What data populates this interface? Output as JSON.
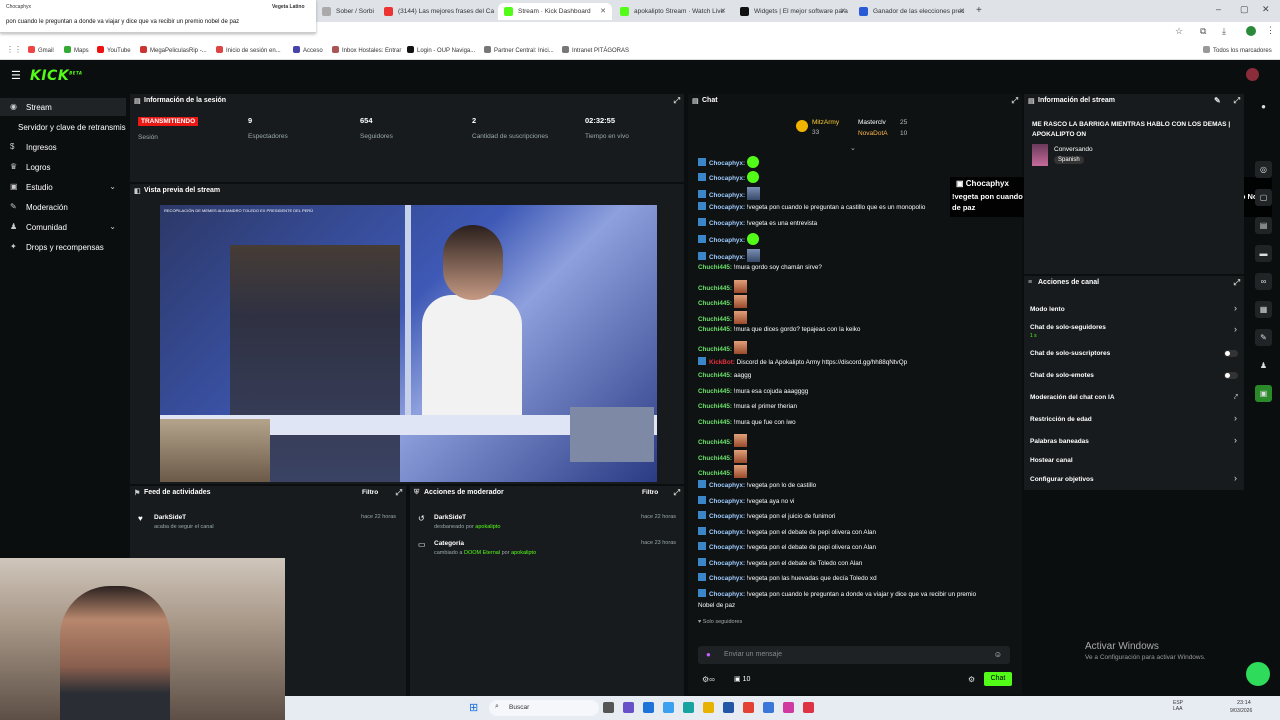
{
  "browser": {
    "tabs": [
      {
        "label": "Sober / Sorbi",
        "color": "#aaa"
      },
      {
        "label": "(3144) Las mejores frases del Ca",
        "color": "#e33"
      },
      {
        "label": "Stream · Kick Dashboard",
        "color": "#53fc18"
      },
      {
        "label": "apokalipto Stream · Watch Live",
        "color": "#53fc18"
      },
      {
        "label": "Widgets | El mejor software para",
        "color": "#111"
      },
      {
        "label": "Ganador de las elecciones prec",
        "color": "#2a5bd7"
      }
    ],
    "new_tab": "+",
    "bookmarks": [
      "Gmail",
      "Maps",
      "YouTube",
      "MegaPeliculasRip -...",
      "Inicio de sesión en...",
      "Acceso",
      "Inbox Hostales: Entrar",
      "Login - OUP Naviga...",
      "Partner Central: Inici...",
      "Intranet PITÁGORAS"
    ],
    "all_bookmarks": "Todos los marcadores",
    "notification": {
      "app": "Chocaphyx",
      "title": "Vegeta Latino",
      "body": "pon cuando le preguntan a donde va viajar y dice que va recibir un premio nobel de paz"
    }
  },
  "kick": {
    "logo": "KICK",
    "logo_sup": "BETA"
  },
  "sidebar": {
    "items": [
      {
        "label": "Stream",
        "icon": "stream-icon",
        "active": true
      },
      {
        "label": "Servidor y clave de retransmisión",
        "icon": "",
        "sub": true
      },
      {
        "label": "Ingresos",
        "icon": "money-icon"
      },
      {
        "label": "Logros",
        "icon": "trophy-icon"
      },
      {
        "label": "Estudio",
        "icon": "studio-icon",
        "chevron": true
      },
      {
        "label": "Moderación",
        "icon": "wrench-icon"
      },
      {
        "label": "Comunidad",
        "icon": "community-icon",
        "chevron": true
      },
      {
        "label": "Drops y recompensas",
        "icon": "gift-icon"
      }
    ]
  },
  "session": {
    "title": "Información de la sesión",
    "status": "TRANSMITIENDO",
    "session_label": "Sesión",
    "stats": [
      {
        "value": "9",
        "label": "Espectadores"
      },
      {
        "value": "654",
        "label": "Seguidores"
      },
      {
        "value": "2",
        "label": "Cantidad de suscripciones"
      },
      {
        "value": "02:32:55",
        "label": "Tiempo en vivo"
      }
    ]
  },
  "preview": {
    "title": "Vista previa del stream",
    "caption": "RECOPILACIÓN DE MEMES ALEJANDRO TOLEDO EX PRESIDENTE DEL PERÚ"
  },
  "activity": {
    "title": "Feed de actividades",
    "filter": "Filtro",
    "rows": [
      {
        "name": "DarkSideT",
        "action": "acaba de seguir el canal",
        "time": "hace 22 horas"
      }
    ]
  },
  "modactions": {
    "title": "Acciones de moderador",
    "filter": "Filtro",
    "rows": [
      {
        "name": "DarkSideT",
        "pre": "desbaneado por",
        "by": "apokalipto",
        "time": "hace 22 horas"
      },
      {
        "name": "Categoría",
        "pre": "cambiado a",
        "target": "DOOM Eternal",
        "mid": "por",
        "by": "apokalipto",
        "time": "hace 23 horas"
      }
    ]
  },
  "chat": {
    "title": "Chat",
    "top": [
      {
        "name": "MitzArmy",
        "count": "33"
      },
      {
        "name": "Masterclv",
        "count": "25"
      },
      {
        "name": "NovaDotA",
        "count": "10"
      }
    ],
    "popup_user": "Chocaphyx",
    "popup_msg": "!vegeta pon cuando le preguntan a donde va viajar y dice que va recibir un premio Nobel de paz",
    "messages": [
      {
        "user": "Chocaphyx:",
        "type": "u1",
        "text": "",
        "emote": "green"
      },
      {
        "user": "Chocaphyx:",
        "type": "u1",
        "text": "",
        "emote": "green"
      },
      {
        "user": "Chocaphyx:",
        "type": "u1",
        "text": "",
        "emote": "img"
      },
      {
        "user": "Chocaphyx:",
        "type": "u1",
        "text": "!vegeta pon cuando le preguntan a castillo que es un monopolio"
      },
      {
        "user": "Chocaphyx:",
        "type": "u1",
        "text": "!vegeta es una entrevista"
      },
      {
        "user": "Chocaphyx:",
        "type": "u1",
        "text": "",
        "emote": "green"
      },
      {
        "user": "Chocaphyx:",
        "type": "u1",
        "text": "",
        "emote": "img"
      },
      {
        "user": "Chuchi445:",
        "type": "u2",
        "text": "!mura gordo soy chamán sirve?"
      },
      {
        "user": "Chuchi445:",
        "type": "u2",
        "text": "",
        "emote": "face"
      },
      {
        "user": "Chuchi445:",
        "type": "u2",
        "text": "",
        "emote": "face"
      },
      {
        "user": "Chuchi445:",
        "type": "u2",
        "text": "",
        "emote": "face"
      },
      {
        "user": "Chuchi445:",
        "type": "u2",
        "text": "!mura que dices gordo? tepajeas con la keiko"
      },
      {
        "user": "Chuchi445:",
        "type": "u2",
        "text": "",
        "emote": "face"
      },
      {
        "user": "KickBot:",
        "type": "u3",
        "text": "Discord de la Apokalipto Army https://discord.gg/hh88qNtvQp"
      },
      {
        "user": "Chuchi445:",
        "type": "u2",
        "text": "aaggg"
      },
      {
        "user": "Chuchi445:",
        "type": "u2",
        "text": "!mura esa cojuda aaagggg"
      },
      {
        "user": "Chuchi445:",
        "type": "u2",
        "text": "!mura el primer therian"
      },
      {
        "user": "Chuchi445:",
        "type": "u2",
        "text": "!mura que fue con iwo"
      },
      {
        "user": "Chuchi445:",
        "type": "u2",
        "text": "",
        "emote": "face"
      },
      {
        "user": "Chuchi445:",
        "type": "u2",
        "text": "",
        "emote": "face"
      },
      {
        "user": "Chuchi445:",
        "type": "u2",
        "text": "",
        "emote": "face"
      },
      {
        "user": "Chocaphyx:",
        "type": "u1",
        "text": "!vegeta pon lo de castillo"
      },
      {
        "user": "Chocaphyx:",
        "type": "u1",
        "text": "!vegeta aya no vi"
      },
      {
        "user": "Chocaphyx:",
        "type": "u1",
        "text": "!vegeta pon el juicio de funimori"
      },
      {
        "user": "Chocaphyx:",
        "type": "u1",
        "text": "!vegeta pon el debate de pepi olivera con Alan"
      },
      {
        "user": "Chocaphyx:",
        "type": "u1",
        "text": "!vegeta pon el debate de pepi olivera con Alan"
      },
      {
        "user": "Chocaphyx:",
        "type": "u1",
        "text": "!vegeta pon el debate de Toledo con Alan"
      },
      {
        "user": "Chocaphyx:",
        "type": "u1",
        "text": "!vegeta pon las huevadas que decía Toledo xd"
      },
      {
        "user": "Chocaphyx:",
        "type": "u1",
        "text": "!vegeta pon cuando le preguntan a donde va viajar y dice que va recibir un premio"
      }
    ],
    "last_wrap": "Nobel de paz",
    "followers_only": "Solo seguidores",
    "input_placeholder": "Enviar un mensaje",
    "viewers": "10",
    "send": "Chat"
  },
  "streaminfo": {
    "title": "Información del stream",
    "stream_title": "ME RASCO LA BARRIGA MIENTRAS HABLO CON LOS DEMAS | APOKALIPTO ON",
    "category": "Conversando",
    "language": "Spanish"
  },
  "channel": {
    "title": "Acciones de canal",
    "items": [
      {
        "label": "Modo lento",
        "control": "chevron"
      },
      {
        "label": "Chat de solo-seguidores",
        "sub": "1 s",
        "control": "chevron"
      },
      {
        "label": "Chat de solo-suscriptores",
        "control": "toggle"
      },
      {
        "label": "Chat de solo-emotes",
        "control": "toggle"
      },
      {
        "label": "Moderación del chat con IA",
        "control": "external"
      },
      {
        "label": "Restricción de edad",
        "control": "chevron"
      },
      {
        "label": "Palabras baneadas",
        "control": "chevron"
      },
      {
        "label": "Hostear canal",
        "control": "none"
      },
      {
        "label": "Configurar objetivos",
        "control": "chevron"
      }
    ]
  },
  "watermark": {
    "line1": "Activar Windows",
    "line2": "Ve a Configuración para activar Windows."
  },
  "taskbar": {
    "search": "Buscar",
    "time": "23:14",
    "date": "9/03/2026",
    "lang": "ESP LAA"
  }
}
